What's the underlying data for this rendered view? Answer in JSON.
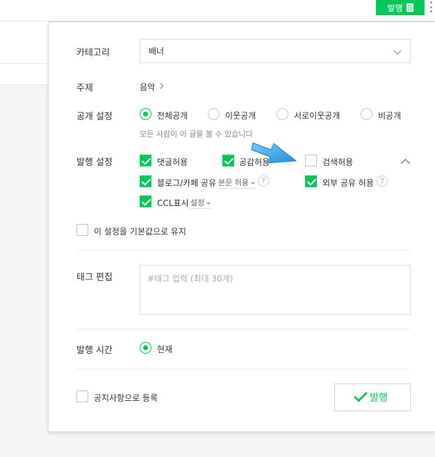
{
  "topbar": {
    "publish_label": "발행"
  },
  "category": {
    "label": "카테고리",
    "value": "배너"
  },
  "topic": {
    "label": "주제",
    "value": "음악"
  },
  "visibility": {
    "label": "공개 설정",
    "options": [
      "전체공개",
      "이웃공개",
      "서로이웃공개",
      "비공개"
    ],
    "selected": "전체공개",
    "hint": "모든 사람이 이 글을 볼 수 있습니다"
  },
  "publish_settings": {
    "label": "발행 설정",
    "comments": {
      "label": "댓글허용",
      "checked": true
    },
    "sympathy": {
      "label": "공감허용",
      "checked": true
    },
    "search": {
      "label": "검색허용",
      "checked": false
    },
    "share": {
      "label": "블로그/카페 공유",
      "checked": true,
      "option": "본문 허용"
    },
    "external": {
      "label": "외부 공유 허용",
      "checked": true
    },
    "ccl": {
      "label": "CCL표시",
      "checked": true,
      "option": "설정"
    },
    "help_glyph": "?"
  },
  "keep_default": {
    "label": "이 설정을 기본값으로 유지",
    "checked": false
  },
  "tags": {
    "label": "태그 편집",
    "placeholder": "#태그 입력 (최대 30개)"
  },
  "publish_time": {
    "label": "발행 시간",
    "option": "현재",
    "selected": true
  },
  "notice": {
    "label": "공지사항으로 등록",
    "checked": false
  },
  "publish_button": {
    "label": "발행"
  },
  "colors": {
    "accent": "#03c75a",
    "arrow": "#3aa6ec"
  }
}
